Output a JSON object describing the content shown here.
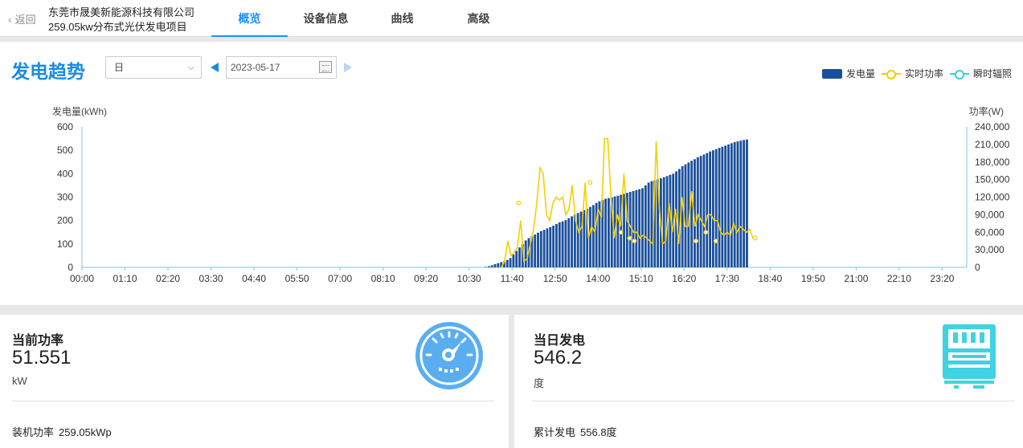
{
  "header": {
    "back_label": "返回",
    "company_line1": "东莞市晟美新能源科技有限公司",
    "company_line2": "259.05kw分布式光伏发电项目",
    "tabs": [
      {
        "label": "概览",
        "active": true
      },
      {
        "label": "设备信息",
        "active": false
      },
      {
        "label": "曲线",
        "active": false
      },
      {
        "label": "高级",
        "active": false
      }
    ]
  },
  "trend": {
    "title": "发电趋势",
    "period_select": "日",
    "date": "2023-05-17",
    "icons": [
      "chevron-down-icon",
      "prev-arrow-icon",
      "calendar-icon",
      "next-arrow-icon"
    ],
    "legend": [
      {
        "label": "发电量",
        "color": "#1a4f9c",
        "kind": "bar"
      },
      {
        "label": "实时功率",
        "color": "#f5cf00",
        "kind": "line"
      },
      {
        "label": "瞬时辐照",
        "color": "#2fd0e0",
        "kind": "line"
      }
    ]
  },
  "chart_data": {
    "type": "bar",
    "left_axis_label": "发电量(kWh)",
    "right_axis_label": "功率(W)",
    "left_ticks": [
      "0",
      "100",
      "200",
      "300",
      "400",
      "500",
      "600"
    ],
    "right_ticks": [
      "0",
      "30,000",
      "60,000",
      "90,000",
      "120,000",
      "150,000",
      "180,000",
      "210,000",
      "240,000"
    ],
    "ylim_left": [
      0,
      600
    ],
    "ylim_right": [
      0,
      240000
    ],
    "x_ticks": [
      "00:00",
      "01:10",
      "02:20",
      "03:30",
      "04:40",
      "05:50",
      "07:00",
      "08:10",
      "09:20",
      "10:30",
      "11:40",
      "12:50",
      "14:00",
      "15:10",
      "16:20",
      "17:30",
      "18:40",
      "19:50",
      "21:00",
      "22:10",
      "23:20"
    ],
    "x_unit_minutes": 5,
    "energy_series": {
      "name": "发电量",
      "start_index": 131,
      "values": [
        2,
        5,
        9,
        14,
        18,
        22,
        26,
        32,
        40,
        55,
        70,
        85,
        100,
        115,
        125,
        133,
        140,
        148,
        155,
        160,
        166,
        172,
        178,
        185,
        192,
        196,
        202,
        210,
        218,
        225,
        232,
        238,
        245,
        250,
        258,
        266,
        275,
        282,
        288,
        293,
        296,
        299,
        303,
        306,
        310,
        314,
        318,
        322,
        326,
        330,
        334,
        338,
        350,
        362,
        368,
        372,
        376,
        380,
        385,
        390,
        395,
        400,
        410,
        420,
        432,
        440,
        448,
        455,
        462,
        470,
        476,
        482,
        488,
        495,
        500,
        505,
        510,
        515,
        520,
        525,
        530,
        535,
        538,
        541,
        544,
        546.2
      ]
    },
    "power_series": {
      "name": "实时功率",
      "start_index": 130,
      "values": [
        0,
        10000,
        45000,
        20000,
        25000,
        35000,
        80000,
        10000,
        15000,
        40000,
        65000,
        110000,
        170000,
        160000,
        90000,
        80000,
        110000,
        120000,
        115000,
        120000,
        90000,
        100000,
        140000,
        80000,
        60000,
        70000,
        145000,
        50000,
        70000,
        60000,
        100000,
        85000,
        220000,
        220000,
        120000,
        50000,
        90000,
        70000,
        160000,
        80000,
        70000,
        60000,
        60000,
        50000,
        55000,
        50000,
        45000,
        40000,
        215000,
        100000,
        40000,
        45000,
        110000,
        60000,
        100000,
        40000,
        120000,
        70000,
        70000,
        130000,
        70000,
        90000,
        80000,
        70000,
        90000,
        90000,
        80000,
        80000,
        60000,
        55000,
        60000,
        55000,
        75000,
        60000,
        70000,
        65000,
        60000,
        65000,
        50000,
        50000
      ],
      "markers": [
        {
          "idx": 14,
          "value": 110000
        },
        {
          "idx": 72,
          "value": 145000
        },
        {
          "idx": 97,
          "value": 60000
        },
        {
          "idx": 104,
          "value": 50000
        },
        {
          "idx": 108,
          "value": 45000
        },
        {
          "idx": 158,
          "value": 45000
        },
        {
          "idx": 166,
          "value": 60000
        },
        {
          "idx": 174,
          "value": 45000
        },
        {
          "idx": 206,
          "value": 50000
        }
      ]
    },
    "irradiance_series": {
      "name": "瞬时辐照",
      "values": []
    },
    "grid": false,
    "legend_position": "top-right"
  },
  "cards": {
    "current_power": {
      "title": "当前功率",
      "value": "51.551",
      "unit": "kW",
      "footer_label": "装机功率",
      "footer_value": "259.05kWp",
      "icon": "speedometer-icon",
      "icon_color": "#5aaef0"
    },
    "daily_energy": {
      "title": "当日发电",
      "value": "546.2",
      "unit": "度",
      "footer_label": "累计发电",
      "footer_value": "556.8度",
      "icon": "electric-meter-icon",
      "icon_color": "#3fd2e2"
    }
  }
}
